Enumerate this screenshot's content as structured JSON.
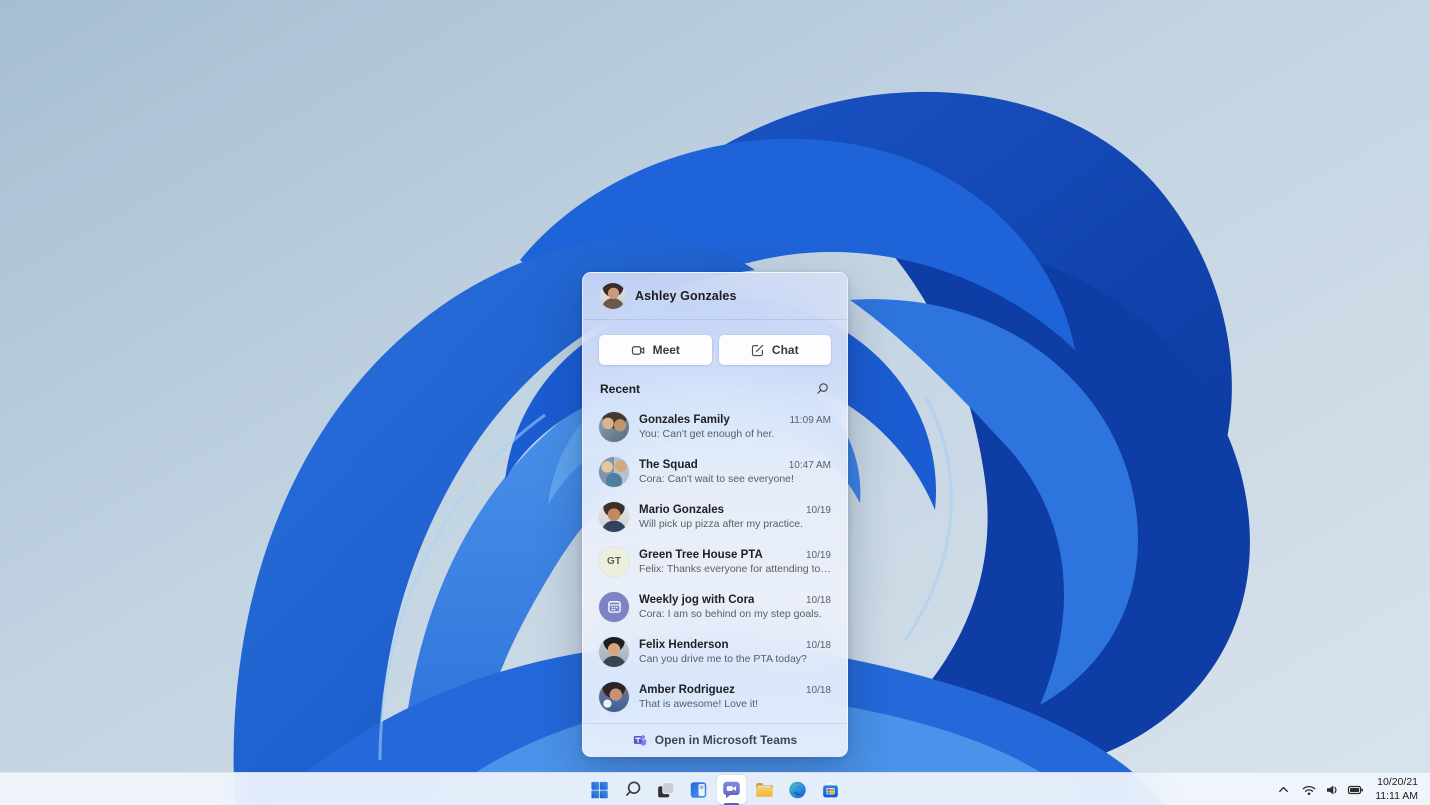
{
  "flyout": {
    "user_name": "Ashley Gonzales",
    "meet_label": "Meet",
    "chat_label": "Chat",
    "recent_heading": "Recent",
    "search_icon": "search-icon",
    "conversations": [
      {
        "name": "Gonzales Family",
        "preview": "You: Can't get enough of her.",
        "time": "11:09 AM",
        "avatar": "family"
      },
      {
        "name": "The Squad",
        "preview": "Cora: Can't wait to see everyone!",
        "time": "10:47 AM",
        "avatar": "squad"
      },
      {
        "name": "Mario Gonzales",
        "preview": "Will pick up pizza after my practice.",
        "time": "10/19",
        "avatar": "mario"
      },
      {
        "name": "Green Tree House PTA",
        "preview": "Felix: Thanks everyone for attending today.",
        "time": "10/19",
        "avatar": "initials",
        "initials": "GT"
      },
      {
        "name": "Weekly jog with Cora",
        "preview": "Cora: I am so behind on my step goals.",
        "time": "10/18",
        "avatar": "calendar",
        "avatar_icon": "calendar-icon"
      },
      {
        "name": "Felix Henderson",
        "preview": "Can you drive me to the PTA today?",
        "time": "10/18",
        "avatar": "felix"
      },
      {
        "name": "Amber Rodriguez",
        "preview": "That is awesome! Love it!",
        "time": "10/18",
        "avatar": "amber"
      }
    ],
    "footer_label": "Open in Microsoft Teams",
    "footer_icon": "teams-logo-icon"
  },
  "taskbar": {
    "items": [
      {
        "label": "Start",
        "icon": "windows-start-icon"
      },
      {
        "label": "Search",
        "icon": "search-icon"
      },
      {
        "label": "Task View",
        "icon": "task-view-icon"
      },
      {
        "label": "Widgets",
        "icon": "widgets-icon"
      },
      {
        "label": "Chat",
        "icon": "teams-chat-icon",
        "active": true
      },
      {
        "label": "File Explorer",
        "icon": "folder-icon"
      },
      {
        "label": "Microsoft Edge",
        "icon": "edge-browser-icon"
      },
      {
        "label": "Microsoft Store",
        "icon": "microsoft-store-icon"
      }
    ],
    "tray": {
      "chevron_icon": "hidden-icons-chevron-icon",
      "status_icons": [
        "wifi-icon",
        "volume-icon",
        "battery-icon"
      ],
      "date": "10/20/21",
      "time": "11:11 AM"
    }
  },
  "colors": {
    "teams_purple": "#6b6fc0",
    "accent_blue": "#2a70dd",
    "active_indicator": "#4a68c4",
    "wallpaper_sky": "#c3d4e2",
    "bloom_dark": "#0e3da6",
    "bloom_bright": "#8ec6f5"
  }
}
